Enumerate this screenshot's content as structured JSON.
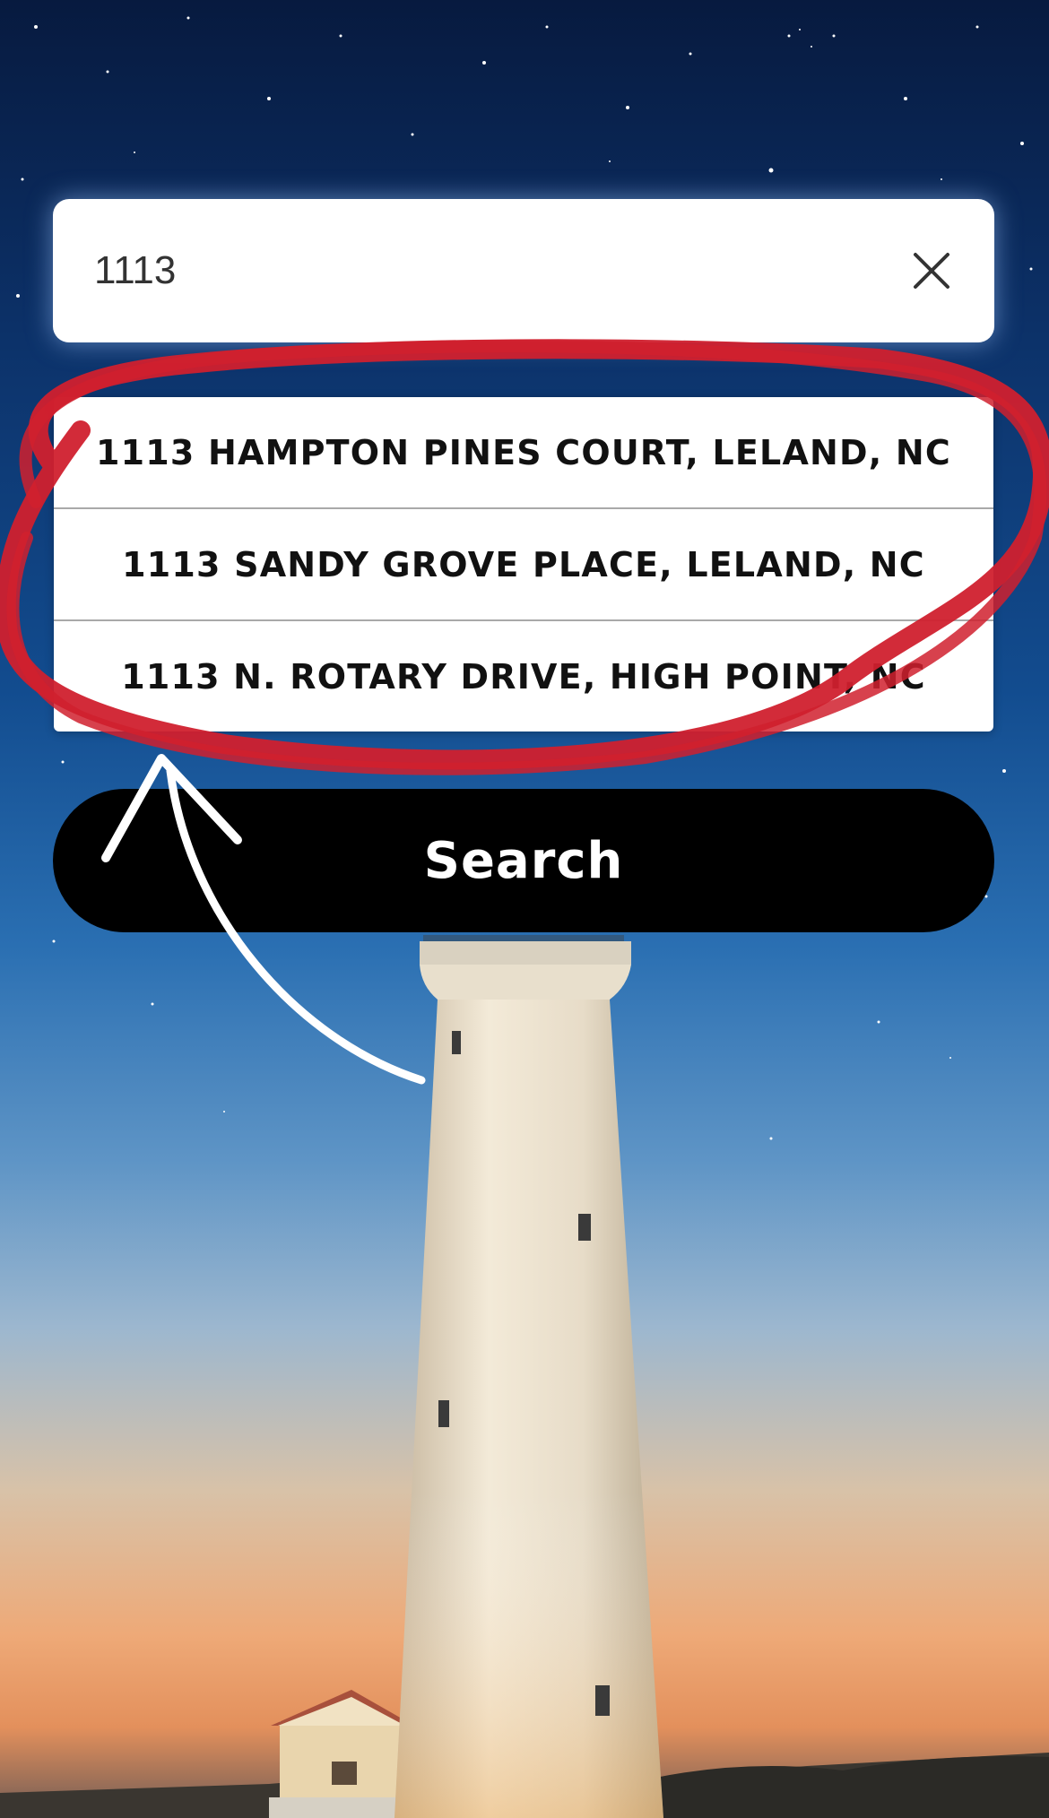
{
  "search": {
    "value": "1113",
    "placeholder": ""
  },
  "clear_icon": "close-icon",
  "suggestions": [
    {
      "label": "1113 HAMPTON PINES COURT, LELAND, NC"
    },
    {
      "label": "1113 SANDY GROVE PLACE, LELAND, NC"
    },
    {
      "label": "1113 N. ROTARY DRIVE, HIGH POINT, NC"
    }
  ],
  "search_button": {
    "label": "Search"
  },
  "colors": {
    "annotation_circle": "#d0202e",
    "annotation_arrow": "#ffffff",
    "button_background": "#000000",
    "sky_top": "#071a3f",
    "horizon": "#eea977"
  }
}
